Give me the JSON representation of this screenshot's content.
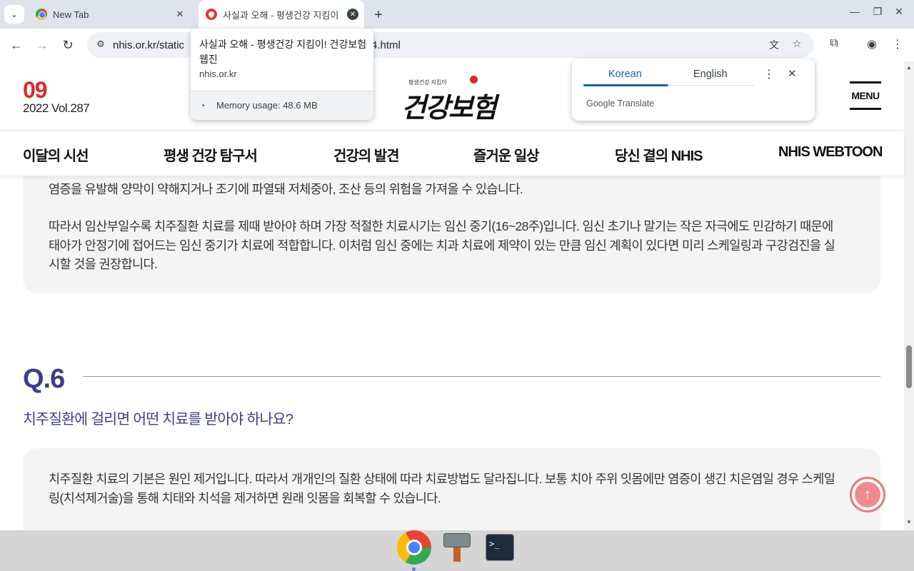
{
  "browser": {
    "tabs": [
      {
        "title": "New Tab",
        "active": false
      },
      {
        "title": "사실과 오해 - 평생건강 지킴이",
        "active": true
      }
    ],
    "url_start": "nhis.or.kr/static",
    "url_end": "4.html"
  },
  "hovercard": {
    "title": "사실과 오해 - 평생건강 지킴이! 건강보험 웹진",
    "domain": "nhis.or.kr",
    "memory": "Memory usage: 48.6 MB"
  },
  "translate": {
    "source_lang": "Korean",
    "target_lang": "English",
    "brand": "Google Translate"
  },
  "header": {
    "issue_month": "09",
    "issue_volume": "2022 Vol.287",
    "logo_subtitle": "평생건강 지킴이",
    "logo_text": "건강보험",
    "menu_label": "MENU"
  },
  "nav": {
    "items": [
      "이달의 시선",
      "평생 건강 탐구서",
      "건강의 발견",
      "즐거운 일상",
      "당신 곁의 NHIS",
      "NHIS WEBTOON"
    ]
  },
  "content": {
    "para_cut": "염증을 유발해 양막이 약해지거나 조기에 파열돼 저체중아, 조산 등의 위험을 가져올 수 있습니다.",
    "para_treatment_1": "따라서 임산부일수록 치주질환 치료를 제때 받아야 하며 가장 적절한 치료시기는 임신 중기(16~28주)입니다. 임신 초기나 말기는 작은 자극에도 민감하기 때문에",
    "para_treatment_2": "태아가 안정기에 접어드는 임신 중기가 치료에 적합합니다. 이처럼 임신 중에는 치과 치료에 제약이 있는 만큼 임신 계획이 있다면 미리 스케일링과 구강검진을 실",
    "para_treatment_3": "시할 것을 권장합니다.",
    "q_label": "Q.6",
    "q_title": "치주질환에 걸리면 어떤 치료를 받아야 하나요?",
    "answer_1": "치주질환 치료의 기본은 원인 제거입니다. 따라서 개개인의 질환 상태에 따라 치료방법도 달라집니다. 보통 치아 주위 잇몸에만 염증이 생긴 치은염일 경우 스케일",
    "answer_2": "링(치석제거술)을 통해 치태와 치석을 제거하면 원래 잇몸을 회복할 수 있습니다."
  },
  "taskbar": {
    "terminal_glyph": ">_"
  }
}
